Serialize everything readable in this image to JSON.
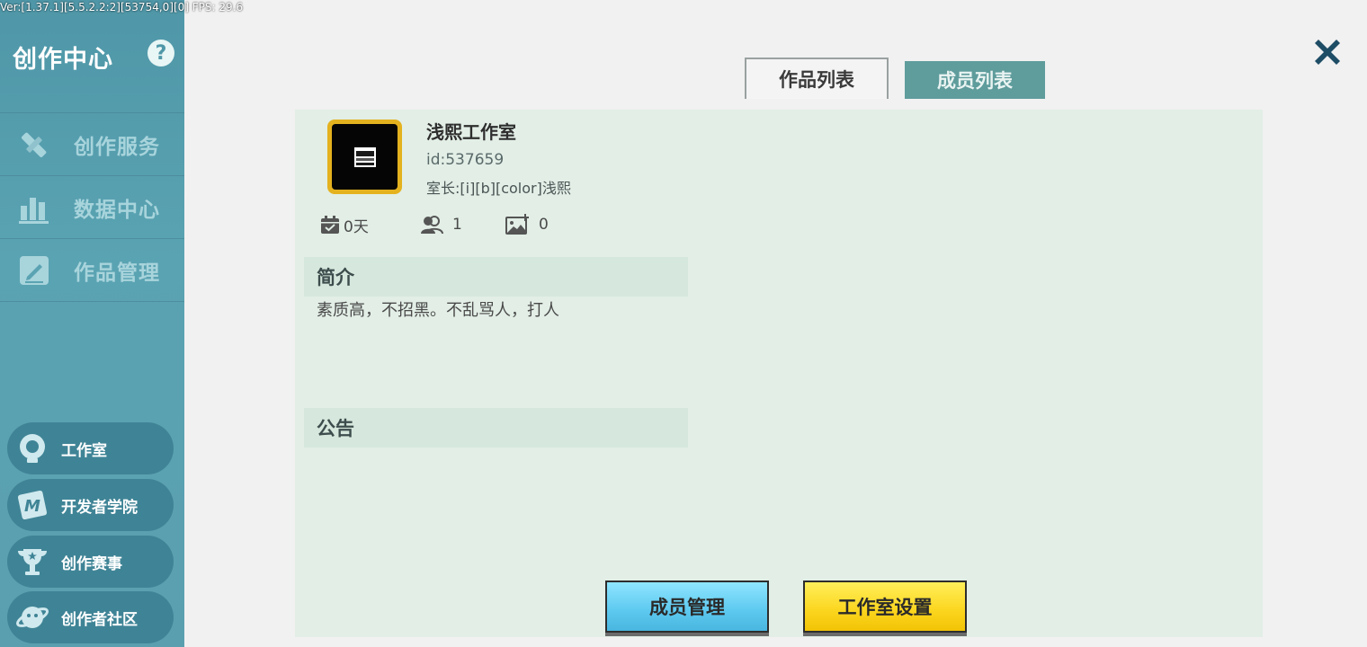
{
  "debug": {
    "version_text": "Ver:[1.37.1][5.5.2.2:2][53754,0][0] FPS: 29.6"
  },
  "sidebar": {
    "title": "创作中心",
    "help_symbol": "?",
    "nav": [
      {
        "label": "创作服务",
        "icon": "pencil-ruler-icon"
      },
      {
        "label": "数据中心",
        "icon": "bar-chart-icon"
      },
      {
        "label": "作品管理",
        "icon": "edit-document-icon"
      }
    ],
    "pills": [
      {
        "label": "工作室",
        "icon": "lightbulb-gear-icon"
      },
      {
        "label": "开发者学院",
        "icon": "book-m-icon"
      },
      {
        "label": "创作赛事",
        "icon": "trophy-icon"
      },
      {
        "label": "创作者社区",
        "icon": "planet-icon"
      }
    ]
  },
  "tabs": {
    "works": "作品列表",
    "members": "成员列表",
    "active": "works"
  },
  "studio": {
    "name": "浅熙工作室",
    "id_text": "id:537659",
    "owner_text": "室长:[i][b][color]浅熙",
    "stats": {
      "days": "0天",
      "members": "1",
      "works": "0"
    }
  },
  "sections": {
    "intro_title": "简介",
    "intro_text": "素质高，不招黑。不乱骂人，打人",
    "notice_title": "公告"
  },
  "buttons": {
    "members_manage": "成员管理",
    "studio_settings": "工作室设置"
  },
  "colors": {
    "sidebar": "#5aa3b2",
    "panel": "#e2eee6",
    "accent_tab": "#5f9c9c",
    "btn_blue": "#5cc8ef",
    "btn_yellow": "#fbd51d",
    "close": "#1e4d66"
  }
}
